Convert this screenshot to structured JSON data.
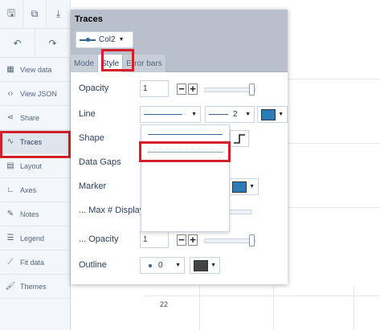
{
  "toolbar": {
    "buttons": [
      {
        "name": "save-icon",
        "glyph": "🖫"
      },
      {
        "name": "copy-icon",
        "glyph": "⧉"
      },
      {
        "name": "download-icon",
        "glyph": "⤓"
      },
      {
        "name": "undo-icon",
        "glyph": "↶"
      },
      {
        "name": "redo-icon",
        "glyph": "↷"
      }
    ]
  },
  "sidebar": {
    "items": [
      {
        "label": "View data",
        "icon": "table-icon",
        "glyph": "▦"
      },
      {
        "label": "View JSON",
        "icon": "code-icon",
        "glyph": "‹›"
      },
      {
        "label": "Share",
        "icon": "share-icon",
        "glyph": "⋖"
      },
      {
        "label": "Traces",
        "icon": "trace-icon",
        "glyph": "∿"
      },
      {
        "label": "Layout",
        "icon": "layout-icon",
        "glyph": "▤"
      },
      {
        "label": "Axes",
        "icon": "axes-icon",
        "glyph": "∟"
      },
      {
        "label": "Notes",
        "icon": "pencil-icon",
        "glyph": "✎"
      },
      {
        "label": "Legend",
        "icon": "legend-icon",
        "glyph": "☰"
      },
      {
        "label": "Fit data",
        "icon": "fit-icon",
        "glyph": "⟋"
      },
      {
        "label": "Themes",
        "icon": "brush-icon",
        "glyph": "🖌"
      }
    ],
    "active_item": "Traces"
  },
  "panel": {
    "title": "Traces",
    "trace_selector": "Col2",
    "tabs": [
      "Mode",
      "Style",
      "Error bars"
    ],
    "active_tab": "Style",
    "rows": {
      "opacity": {
        "label": "Opacity",
        "value": "1"
      },
      "line": {
        "label": "Line",
        "width_value": "2",
        "color": "#2b7bb9"
      },
      "shape": {
        "label": "Shape"
      },
      "data_gaps": {
        "label": "Data Gaps"
      },
      "marker": {
        "label": "Marker",
        "color": "#2b7bb9"
      },
      "max_display": {
        "label": "... Max # Display"
      },
      "marker_opacity": {
        "label": "... Opacity",
        "value": "1"
      },
      "outline": {
        "label": "Outline",
        "width_value": "0",
        "color": "#444444"
      }
    }
  },
  "dash_menu": {
    "options": [
      "solid",
      "dot",
      "dash",
      "longdash",
      "dashdot",
      "longdashdot"
    ],
    "highlighted": "dot"
  },
  "plot": {
    "tick_label": "22"
  },
  "colors": {
    "accent": "#336699",
    "highlight": "#d4202a",
    "panel_header": "#b7c0cb"
  }
}
